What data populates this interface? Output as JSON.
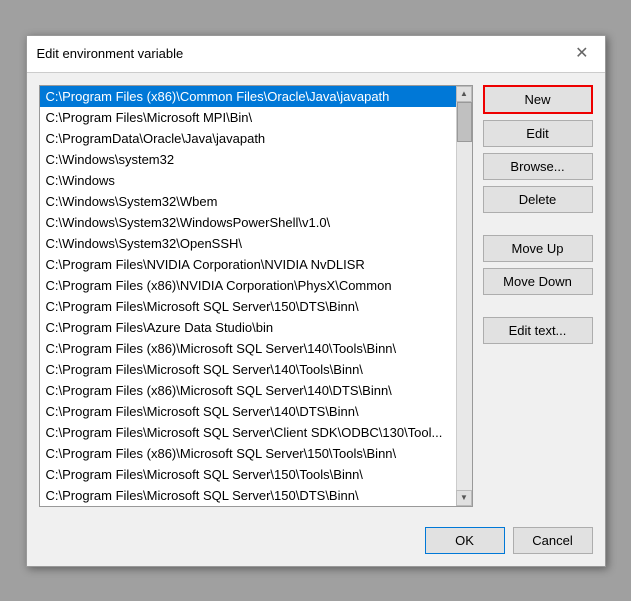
{
  "dialog": {
    "title": "Edit environment variable",
    "close_label": "✕"
  },
  "buttons": {
    "new_label": "New",
    "edit_label": "Edit",
    "browse_label": "Browse...",
    "delete_label": "Delete",
    "move_up_label": "Move Up",
    "move_down_label": "Move Down",
    "edit_text_label": "Edit text...",
    "ok_label": "OK",
    "cancel_label": "Cancel"
  },
  "list": {
    "items": [
      "C:\\Program Files (x86)\\Common Files\\Oracle\\Java\\javapath",
      "C:\\Program Files\\Microsoft MPI\\Bin\\",
      "C:\\ProgramData\\Oracle\\Java\\javapath",
      "C:\\Windows\\system32",
      "C:\\Windows",
      "C:\\Windows\\System32\\Wbem",
      "C:\\Windows\\System32\\WindowsPowerShell\\v1.0\\",
      "C:\\Windows\\System32\\OpenSSH\\",
      "C:\\Program Files\\NVIDIA Corporation\\NVIDIA NvDLISR",
      "C:\\Program Files (x86)\\NVIDIA Corporation\\PhysX\\Common",
      "C:\\Program Files\\Microsoft SQL Server\\150\\DTS\\Binn\\",
      "C:\\Program Files\\Azure Data Studio\\bin",
      "C:\\Program Files (x86)\\Microsoft SQL Server\\140\\Tools\\Binn\\",
      "C:\\Program Files\\Microsoft SQL Server\\140\\Tools\\Binn\\",
      "C:\\Program Files (x86)\\Microsoft SQL Server\\140\\DTS\\Binn\\",
      "C:\\Program Files\\Microsoft SQL Server\\140\\DTS\\Binn\\",
      "C:\\Program Files\\Microsoft SQL Server\\Client SDK\\ODBC\\130\\Tool...",
      "C:\\Program Files (x86)\\Microsoft SQL Server\\150\\Tools\\Binn\\",
      "C:\\Program Files\\Microsoft SQL Server\\150\\Tools\\Binn\\",
      "C:\\Program Files\\Microsoft SQL Server\\150\\DTS\\Binn\\"
    ],
    "selected_index": 0
  }
}
